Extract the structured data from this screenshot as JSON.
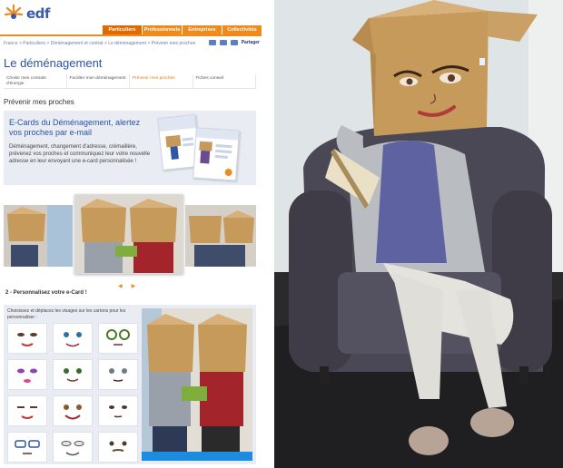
{
  "site": {
    "brand": "EDF",
    "logo_text": "edf",
    "nav": [
      "Particuliers",
      "Professionnels",
      "Entreprises",
      "Collectivités"
    ],
    "breadcrumb": "France > Particuliers > Déménagement et contrat > Le déménagement > Prévenir mes proches",
    "tools_label": "Partager",
    "page_title": "Le déménagement",
    "subtabs": [
      "Choisir mes contrats d'énergie",
      "Faciliter mon déménagement",
      "Prévenir mes proches",
      "Fiches conseil"
    ],
    "section_title": "Prévenir mes proches",
    "hero": {
      "title": "E-Cards du Déménagement, alertez vos proches par e-mail",
      "text": "Déménagement, changement d'adresse, crémaillère, prévenez vos proches et communiquez leur votre nouvelle adresse en leur envoyant une e-card personnalisée !"
    },
    "pager": {
      "prev": "◀",
      "next": "▶"
    },
    "step_title": "2 - Personnalisez votre e-Card !",
    "custom_text": "Choisissez et déplacez les visages sur les cartons pour les personnaliser :"
  },
  "colors": {
    "brand_orange": "#f18a1c",
    "brand_blue": "#2a52a4",
    "panel_bg": "#e9edf3",
    "cardboard": "#c59a5a"
  },
  "icons": [
    "edf-logo-icon",
    "print-icon",
    "email-icon",
    "bookmark-icon",
    "share-icon",
    "prev-arrow-icon",
    "next-arrow-icon"
  ]
}
